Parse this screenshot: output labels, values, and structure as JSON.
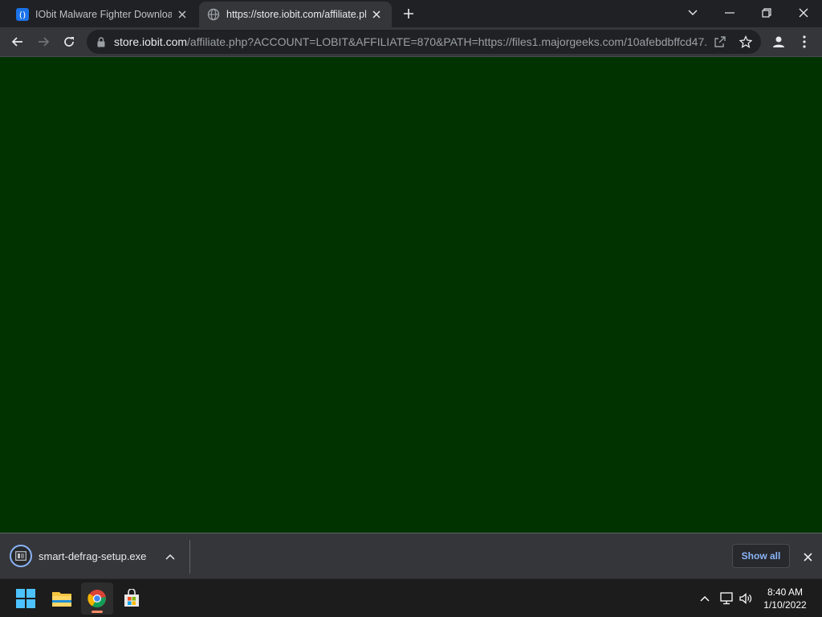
{
  "browser": {
    "tabs": [
      {
        "title": "IObit Malware Fighter Download",
        "favicon": "iobit-favicon",
        "active": false
      },
      {
        "title": "https://store.iobit.com/affiliate.php",
        "favicon": "globe-icon",
        "active": true
      }
    ],
    "url_host": "store.iobit.com",
    "url_rest": "/affiliate.php?ACCOUNT=LOBIT&AFFILIATE=870&PATH=https://files1.majorgeeks.com/10afebdbffcd47..."
  },
  "page": {
    "background_color": "#003300"
  },
  "download_shelf": {
    "file_name": "smart-defrag-setup.exe",
    "show_all_label": "Show all"
  },
  "taskbar": {
    "apps": [
      "windows-start-icon",
      "file-explorer-icon",
      "chrome-icon",
      "microsoft-store-icon"
    ],
    "time": "8:40 AM",
    "date": "1/10/2022"
  },
  "colors": {
    "accent": "#8ab4f8",
    "chrome_dark": "#202124",
    "toolbar": "#35363a"
  }
}
